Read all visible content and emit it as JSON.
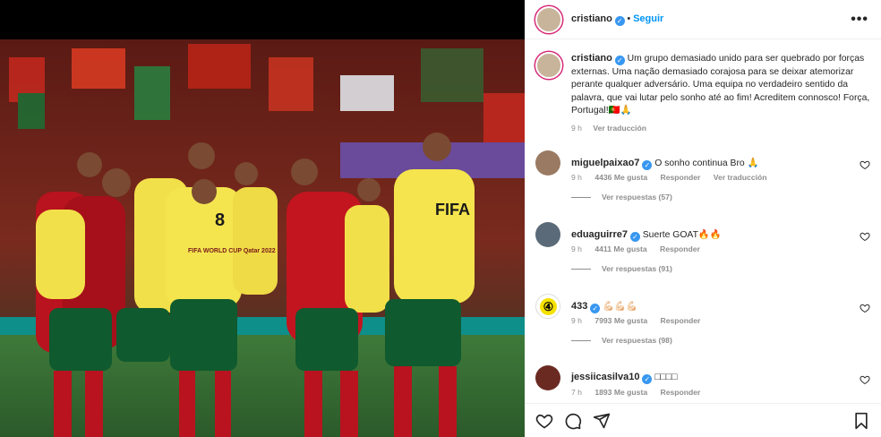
{
  "post": {
    "author": "cristiano",
    "follow_label": "Seguir",
    "separator": "•",
    "more_label": "•••"
  },
  "caption": {
    "author": "cristiano",
    "text": "Um grupo demasiado unido para ser quebrado por forças externas. Uma nação demasiado corajosa para se deixar atemorizar perante qualquer adversário. Uma equipa no verdadeiro sentido da palavra, que vai lutar pelo sonho até ao fim! Acreditem connosco! Força, Portugal!🇵🇹🙏",
    "time": "9 h",
    "translate_label": "Ver traducción"
  },
  "comments": [
    {
      "user": "miguelpaixao7",
      "text": "O sonho continua Bro 🙏",
      "time": "9 h",
      "likes": "4436 Me gusta",
      "reply_label": "Responder",
      "translate_label": "Ver traducción",
      "replies_label": "Ver respuestas (57)"
    },
    {
      "user": "eduaguirre7",
      "text": "Suerte GOAT🔥🔥",
      "time": "9 h",
      "likes": "4411 Me gusta",
      "reply_label": "Responder",
      "replies_label": "Ver respuestas (91)"
    },
    {
      "user": "433",
      "text": "💪🏻💪🏻💪🏻",
      "time": "9 h",
      "likes": "7993 Me gusta",
      "reply_label": "Responder",
      "replies_label": "Ver respuestas (98)"
    },
    {
      "user": "jessiicasilva10",
      "text": "□□□□",
      "time": "7 h",
      "likes": "1893 Me gusta",
      "reply_label": "Responder"
    }
  ],
  "badge_433": "④",
  "photo": {
    "jersey_text": "FIFA",
    "bib_text": "FIFA WORLD CUP Qatar 2022",
    "bib_number": "8"
  },
  "colors": {
    "accent": "#0095f6",
    "verified": "#3897f0",
    "muted": "#8e8e8e",
    "portugal_red": "#b8131e",
    "portugal_green": "#0f5a2e",
    "bib_yellow": "#f2e04a"
  },
  "icons": {
    "like": "heart-icon",
    "comment": "comment-icon",
    "share": "share-icon",
    "save": "bookmark-icon",
    "more": "more-icon"
  }
}
